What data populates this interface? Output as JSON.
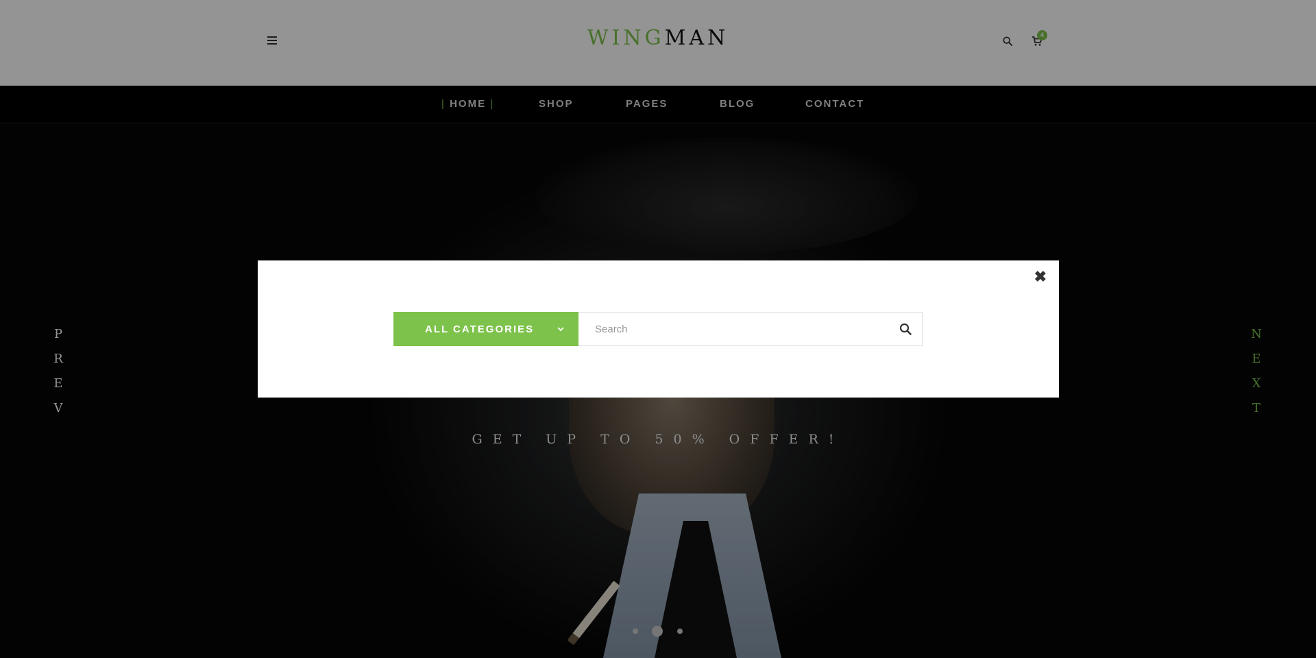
{
  "header": {
    "menu_icon": "hamburger-menu-icon",
    "logo_part1": "WING",
    "logo_part2": "MAN",
    "search_icon": "search-icon",
    "cart_icon": "cart-icon",
    "cart_count": "4"
  },
  "nav": {
    "items": [
      {
        "label": "HOME",
        "active": true
      },
      {
        "label": "SHOP"
      },
      {
        "label": "PAGES"
      },
      {
        "label": "BLOG"
      },
      {
        "label": "CONTACT"
      }
    ]
  },
  "hero": {
    "sub": "GET UP TO 50% OFFER!",
    "prev_letters": [
      "P",
      "R",
      "E",
      "V"
    ],
    "next_letters": [
      "N",
      "E",
      "X",
      "T"
    ],
    "dots_count": 3,
    "active_dot": 2
  },
  "search_modal": {
    "category_label": "ALL CATEGORIES",
    "search_placeholder": "Search",
    "search_value": "",
    "close_symbol": "✖"
  },
  "colors": {
    "accent": "#7dc24b",
    "header_bg": "#ffffff",
    "nav_bg": "#000000"
  }
}
